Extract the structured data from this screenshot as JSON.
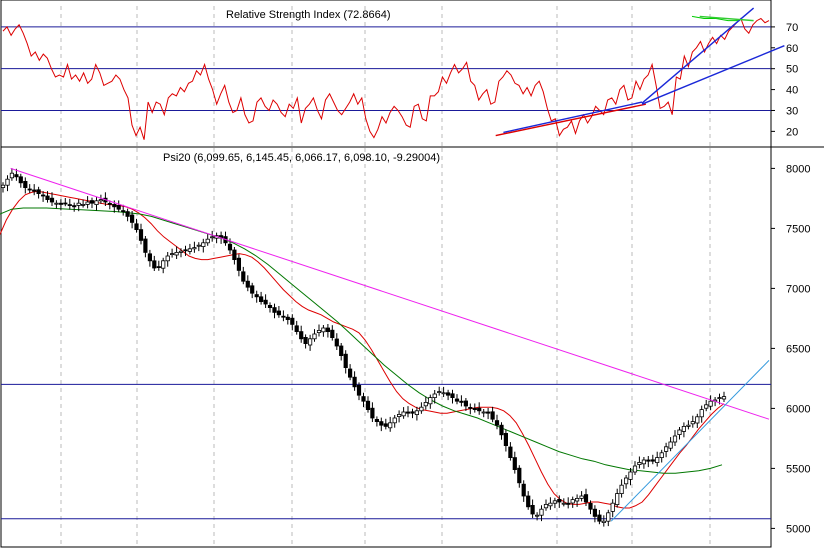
{
  "chart_data": [
    {
      "type": "line",
      "panel": "rsi",
      "title": "Relative Strength Index (72.8664)",
      "yticks": [
        20,
        30,
        40,
        50,
        60,
        70
      ],
      "ylim": [
        13,
        80
      ],
      "reference_levels": [
        70,
        50,
        30
      ],
      "grid": "vertical dashed",
      "series": [
        {
          "color": "#dd0000",
          "values": [
            68,
            70,
            66,
            69,
            71,
            67,
            62,
            56,
            58,
            54,
            57,
            55,
            50,
            46,
            47,
            46,
            52,
            45,
            47,
            44,
            48,
            43,
            45,
            52,
            48,
            42,
            43,
            44,
            47,
            45,
            40,
            36,
            23,
            18,
            22,
            16,
            34,
            29,
            34,
            33,
            28,
            36,
            38,
            37,
            41,
            39,
            43,
            44,
            49,
            47,
            52,
            45,
            40,
            33,
            38,
            42,
            34,
            29,
            30,
            36,
            28,
            24,
            25,
            34,
            36,
            32,
            30,
            35,
            33,
            29,
            27,
            33,
            31,
            36,
            24,
            31,
            33,
            36,
            30,
            26,
            35,
            38,
            34,
            30,
            28,
            31,
            34,
            38,
            33,
            36,
            26,
            20,
            17,
            21,
            27,
            24,
            29,
            32,
            30,
            27,
            23,
            22,
            32,
            33,
            26,
            25,
            37,
            37,
            39,
            46,
            43,
            48,
            52,
            48,
            50,
            53,
            44,
            42,
            35,
            38,
            40,
            33,
            34,
            44,
            46,
            49,
            47,
            43,
            42,
            38,
            41,
            37,
            42,
            44,
            39,
            31,
            25,
            26,
            18,
            21,
            22,
            25,
            19,
            25,
            28,
            24,
            27,
            32,
            30,
            28,
            35,
            36,
            33,
            40,
            42,
            35,
            36,
            44,
            40,
            45,
            47,
            52,
            42,
            31,
            32,
            34,
            28,
            46,
            45,
            56,
            51,
            58,
            60,
            63,
            58,
            62,
            65,
            62,
            66,
            64,
            68,
            70,
            72,
            74,
            69,
            67,
            71,
            73,
            74,
            72,
            73
          ]
        },
        {
          "color": "#00cc00",
          "values": [
            75,
            74,
            74,
            73,
            73
          ]
        }
      ],
      "trendlines": [
        {
          "color": "#dd0000",
          "from": [
            128,
            18
          ],
          "to": [
            167,
            33
          ]
        },
        {
          "color": "#1a28d8",
          "from": [
            130,
            19.5
          ],
          "to": [
            166,
            34
          ]
        },
        {
          "color": "#1a28d8",
          "from": [
            166,
            33.5
          ],
          "to": [
            195,
            79
          ]
        },
        {
          "color": "#1a28d8",
          "from": [
            166,
            33
          ],
          "to": [
            203,
            61
          ]
        },
        {
          "color": "#33cc33",
          "from": [
            181,
            75
          ],
          "to": [
            195,
            73
          ]
        }
      ]
    },
    {
      "type": "candlestick",
      "panel": "price",
      "title": "Psi20 (6,099.65, 6,145.45, 6,066.17, 6,098.10, -9.29004)",
      "yticks": [
        5000,
        5500,
        6000,
        6500,
        7000,
        7500,
        8000
      ],
      "ylim": [
        4845,
        8170
      ],
      "reference_levels": [
        6200,
        5080
      ],
      "grid": "vertical dashed",
      "close": [
        7860,
        7910,
        7960,
        7930,
        7880,
        7840,
        7820,
        7810,
        7790,
        7770,
        7740,
        7720,
        7710,
        7700,
        7710,
        7690,
        7680,
        7710,
        7700,
        7720,
        7710,
        7730,
        7740,
        7720,
        7700,
        7680,
        7660,
        7640,
        7600,
        7550,
        7490,
        7400,
        7300,
        7230,
        7170,
        7180,
        7230,
        7270,
        7290,
        7300,
        7310,
        7320,
        7330,
        7340,
        7360,
        7380,
        7410,
        7430,
        7440,
        7420,
        7380,
        7320,
        7240,
        7150,
        7060,
        7010,
        6960,
        6930,
        6890,
        6870,
        6840,
        6800,
        6780,
        6760,
        6740,
        6700,
        6640,
        6580,
        6540,
        6580,
        6620,
        6650,
        6670,
        6640,
        6590,
        6520,
        6440,
        6340,
        6260,
        6180,
        6110,
        6060,
        5990,
        5920,
        5890,
        5860,
        5850,
        5880,
        5920,
        5950,
        5970,
        5960,
        5960,
        5980,
        6010,
        6050,
        6090,
        6120,
        6140,
        6130,
        6110,
        6090,
        6060,
        6050,
        6020,
        6000,
        5990,
        5980,
        5970,
        5960,
        5910,
        5860,
        5780,
        5690,
        5590,
        5490,
        5380,
        5270,
        5180,
        5120,
        5110,
        5160,
        5200,
        5210,
        5230,
        5220,
        5210,
        5200,
        5240,
        5250,
        5270,
        5220,
        5160,
        5100,
        5060,
        5060,
        5130,
        5210,
        5290,
        5360,
        5420,
        5470,
        5520,
        5550,
        5570,
        5560,
        5560,
        5590,
        5630,
        5680,
        5720,
        5770,
        5820,
        5850,
        5860,
        5890,
        5930,
        5990,
        6030,
        6060,
        6070,
        6090,
        6098
      ],
      "ma_red": {
        "color": "#dd0000",
        "values": [
          7450,
          7570,
          7660,
          7730,
          7780,
          7800,
          7810,
          7800,
          7790,
          7780,
          7770,
          7760,
          7750,
          7740,
          7730,
          7720,
          7710,
          7700,
          7695,
          7690,
          7680,
          7660,
          7630,
          7590,
          7540,
          7480,
          7430,
          7390,
          7350,
          7310,
          7270,
          7250,
          7240,
          7240,
          7250,
          7260,
          7270,
          7280,
          7290,
          7280,
          7260,
          7220,
          7170,
          7110,
          7050,
          6990,
          6940,
          6890,
          6850,
          6820,
          6800,
          6780,
          6750,
          6720,
          6700,
          6680,
          6660,
          6630,
          6570,
          6490,
          6400,
          6310,
          6220,
          6140,
          6080,
          6040,
          6010,
          5990,
          5980,
          5970,
          5960,
          5960,
          5970,
          5980,
          5990,
          6000,
          6010,
          6010,
          6010,
          6000,
          5980,
          5940,
          5880,
          5790,
          5690,
          5580,
          5470,
          5370,
          5290,
          5240,
          5210,
          5200,
          5200,
          5210,
          5220,
          5220,
          5210,
          5200,
          5180,
          5170,
          5170,
          5190,
          5220,
          5280,
          5350,
          5420,
          5490,
          5560,
          5630,
          5690,
          5760,
          5830,
          5890,
          5950,
          6000,
          6040
        ]
      },
      "ma_green": {
        "color": "#007700",
        "values": [
          7620,
          7660,
          7670,
          7670,
          7670,
          7665,
          7660,
          7655,
          7650,
          7645,
          7640,
          7630,
          7620,
          7600,
          7570,
          7540,
          7510,
          7480,
          7450,
          7420,
          7380,
          7330,
          7270,
          7200,
          7120,
          7040,
          6960,
          6880,
          6800,
          6720,
          6630,
          6540,
          6450,
          6360,
          6280,
          6200,
          6130,
          6070,
          6020,
          5980,
          5950,
          5920,
          5880,
          5840,
          5800,
          5760,
          5720,
          5680,
          5640,
          5610,
          5580,
          5560,
          5530,
          5510,
          5490,
          5480,
          5470,
          5460,
          5460,
          5470,
          5480,
          5500,
          5530
        ]
      },
      "trendlines": [
        {
          "color": "#ee22ee",
          "from": [
            2,
            8000
          ],
          "to": [
            199,
            5910
          ]
        },
        {
          "color": "#3399dd",
          "from": [
            158,
            5060
          ],
          "to": [
            199,
            6400
          ]
        }
      ]
    }
  ]
}
